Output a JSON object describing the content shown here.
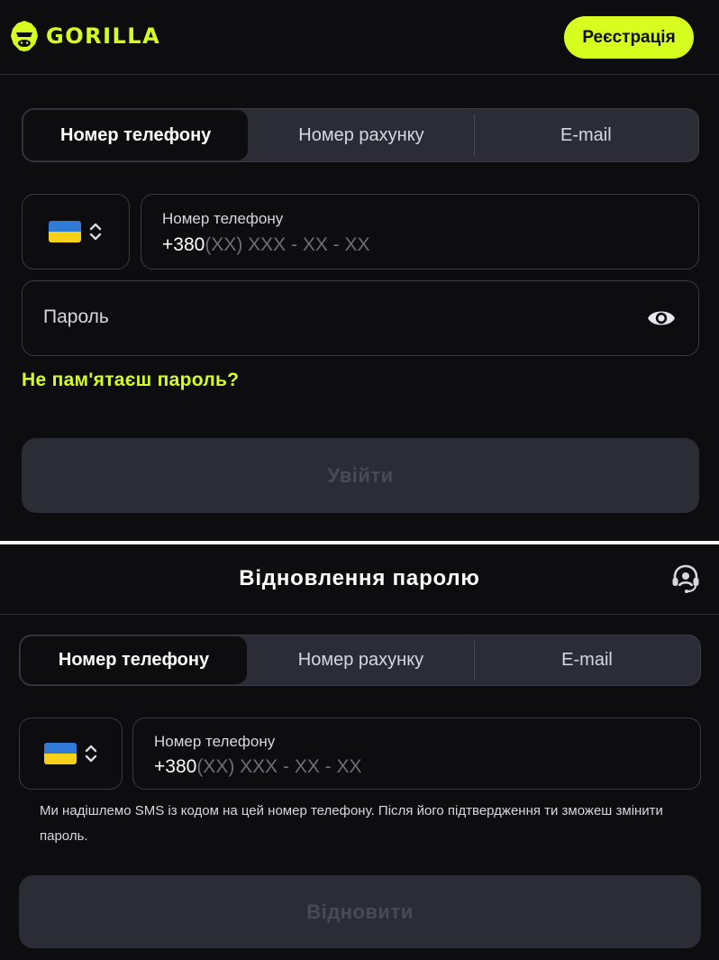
{
  "login": {
    "logo_text": "GORILLA",
    "register_label": "Реєстрація",
    "tabs": [
      "Номер телефону",
      "Номер рахунку",
      "E-mail"
    ],
    "phone": {
      "label": "Номер телефону",
      "prefix": "+380",
      "mask": "(XX) XXX - XX - XX"
    },
    "password_placeholder": "Пароль",
    "forgot_link": "Не пам'ятаєш пароль?",
    "submit_label": "Увійти"
  },
  "recovery": {
    "title": "Відновлення паролю",
    "tabs": [
      "Номер телефону",
      "Номер рахунку",
      "E-mail"
    ],
    "phone": {
      "label": "Номер телефону",
      "prefix": "+380",
      "mask": "(XX) XXX - XX - XX"
    },
    "hint": "Ми надішлемо SMS із кодом на цей номер телефону. Після його підтвердження ти зможеш змінити пароль.",
    "submit_label": "Відновити"
  },
  "colors": {
    "accent": "#d6ff1f",
    "background": "#0d0d0f",
    "surface": "#2c2c36",
    "border": "#3a3a44"
  },
  "icons": {
    "logo": "gorilla-logo-icon",
    "eye": "eye-icon",
    "chevron": "chevron-updown-icon",
    "support": "headset-icon",
    "flag": "ukraine-flag-icon"
  }
}
